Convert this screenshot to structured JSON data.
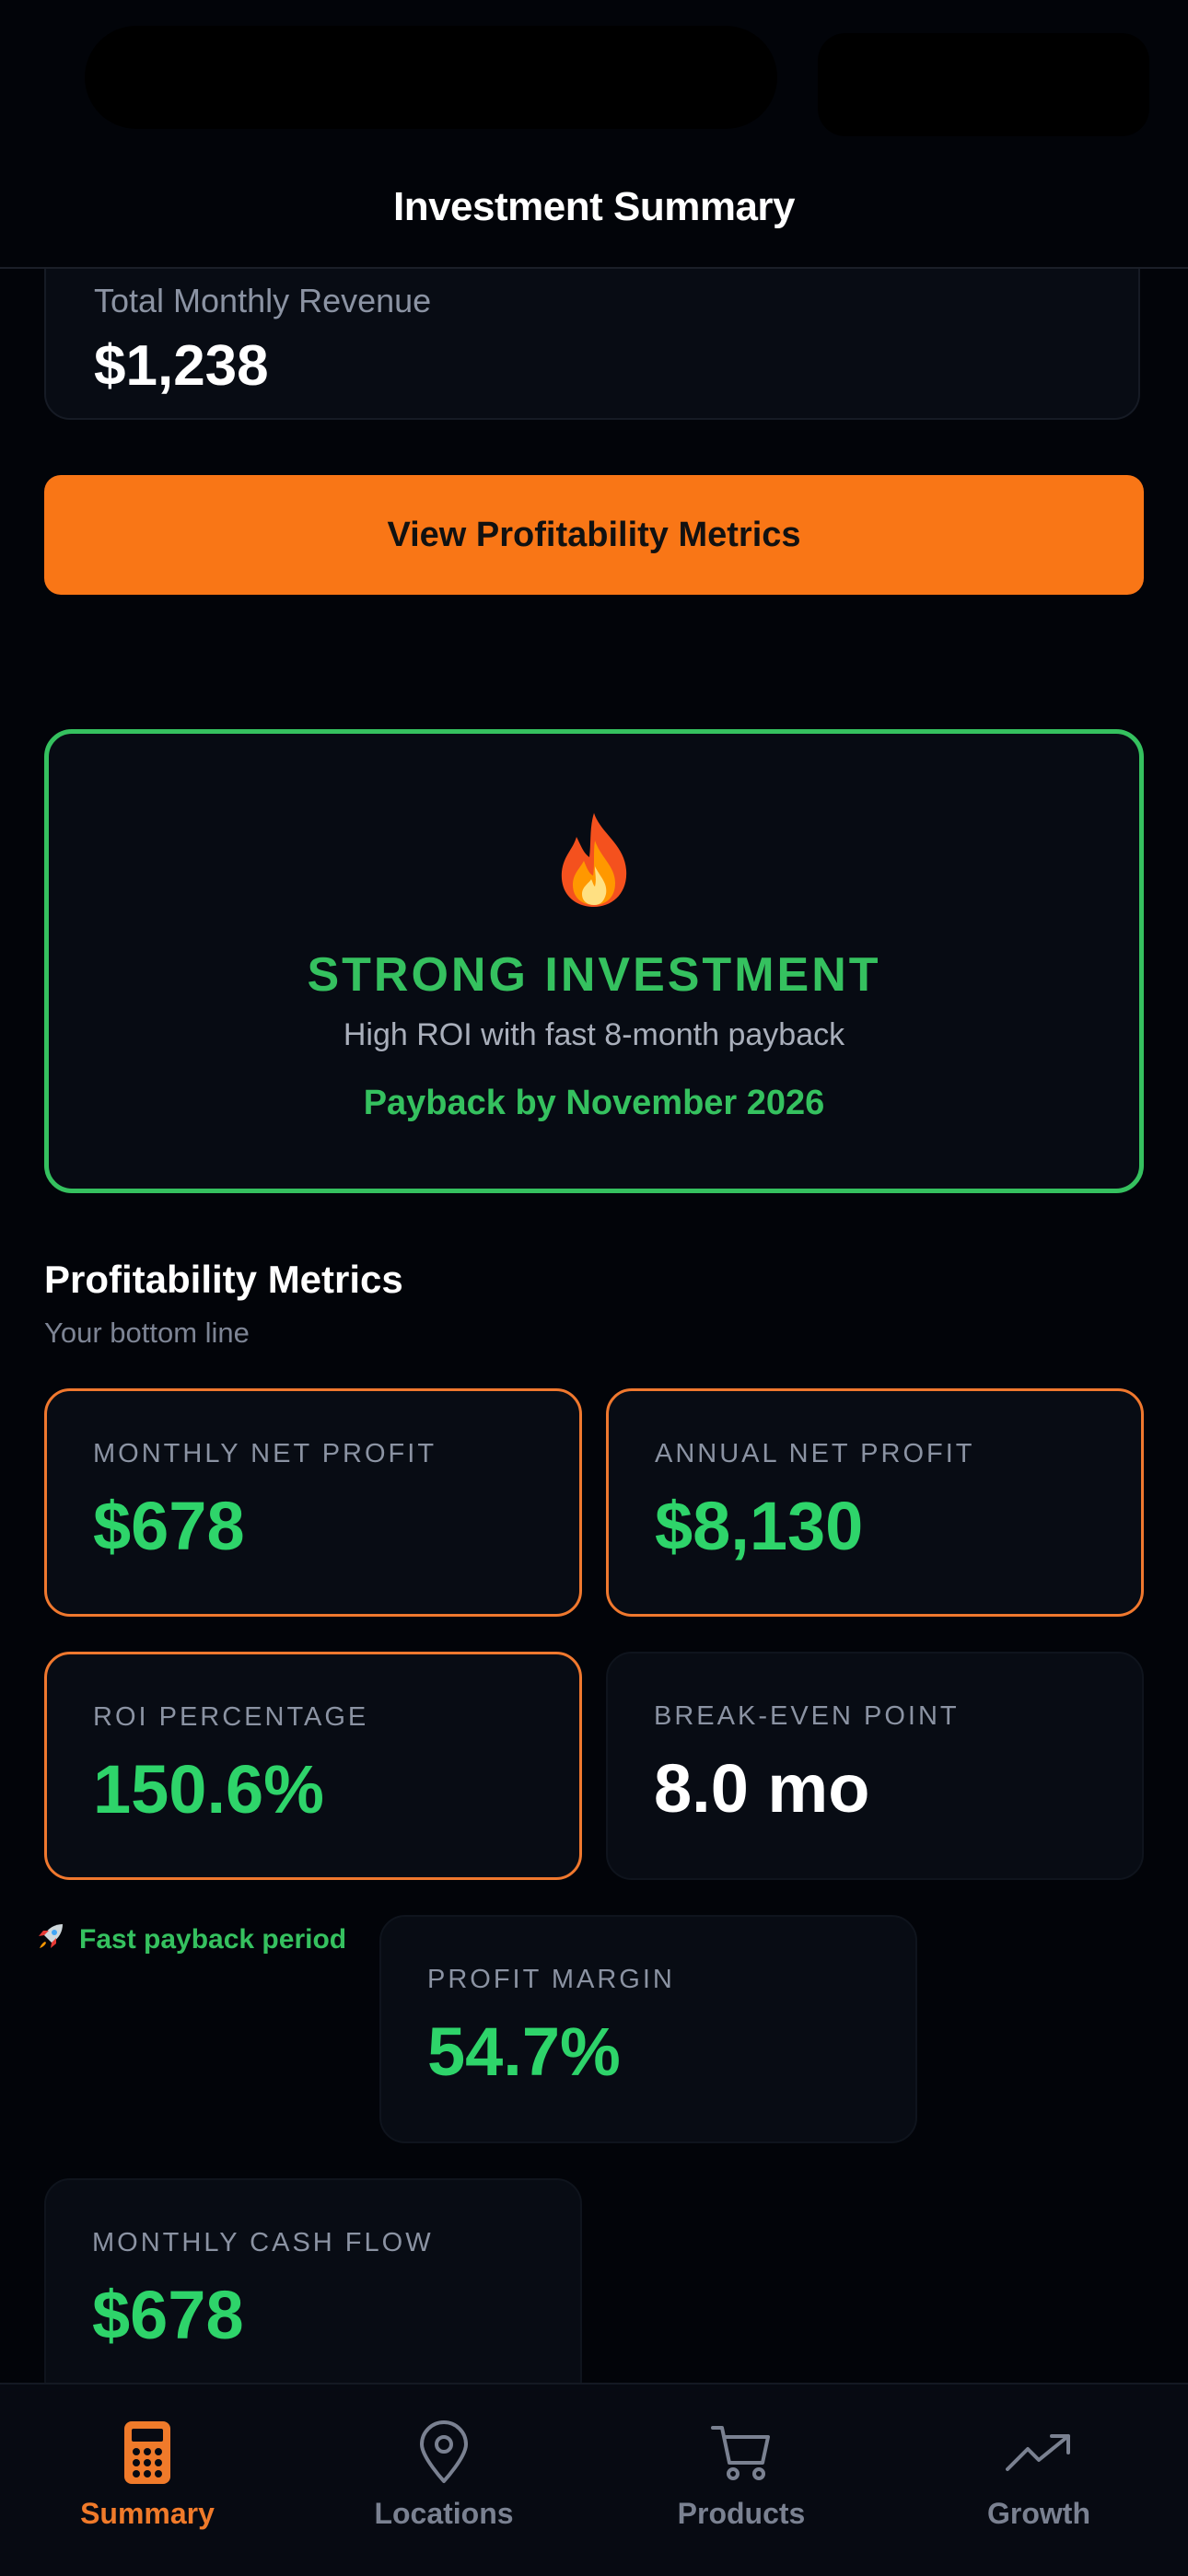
{
  "nav": {
    "title": "Investment Summary"
  },
  "revenue": {
    "label": "Total Monthly Revenue",
    "value": "$1,238"
  },
  "cta": {
    "label": "View Profitability Metrics"
  },
  "verdict": {
    "icon": "fire-icon",
    "title": "STRONG INVESTMENT",
    "subtitle": "High ROI with fast 8-month payback",
    "payback": "Payback by November 2026"
  },
  "section": {
    "title": "Profitability Metrics",
    "subtitle": "Your bottom line"
  },
  "metrics": [
    {
      "label": "MONTHLY NET PROFIT",
      "value": "$678"
    },
    {
      "label": "ANNUAL NET PROFIT",
      "value": "$8,130"
    },
    {
      "label": "ROI PERCENTAGE",
      "value": "150.6%"
    },
    {
      "label": "BREAK-EVEN POINT",
      "value": "8.0 mo"
    },
    {
      "label": "PROFIT MARGIN",
      "value": "54.7%"
    },
    {
      "label": "MONTHLY CASH FLOW",
      "value": "$678"
    }
  ],
  "note": {
    "icon": "rocket-icon",
    "text": "Fast payback period"
  },
  "tabs": [
    {
      "label": "Summary",
      "icon": "calculator-icon",
      "active": true
    },
    {
      "label": "Locations",
      "icon": "map-pin-icon"
    },
    {
      "label": "Products",
      "icon": "cart-icon"
    },
    {
      "label": "Growth",
      "icon": "trend-up-icon"
    }
  ],
  "colors": {
    "accent": "#f97616",
    "success": "#35c15f",
    "value_green": "#2ed46a",
    "background": "#020409"
  }
}
